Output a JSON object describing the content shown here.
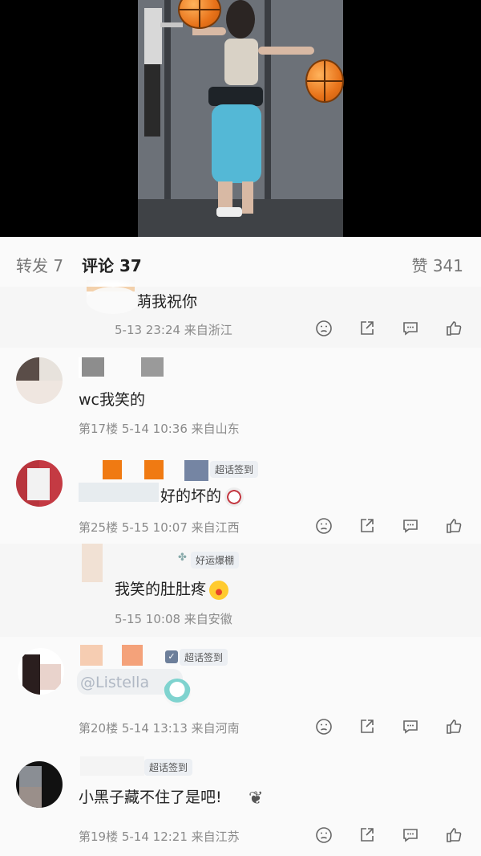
{
  "tabs": {
    "repost": "转发 7",
    "comments": "评论 37",
    "likes": "赞 341"
  },
  "comments": [
    {
      "text": "萌我祝你",
      "meta": "5-13 23:24 来自浙江",
      "is_reply": true
    },
    {
      "text": "wc我笑的",
      "meta": "第17楼 5-14 10:36 来自山东",
      "is_reply": false
    },
    {
      "badge": "超话签到",
      "text": "好的坏的",
      "meta": "第25楼 5-15 10:07 来自江西",
      "is_reply": false
    },
    {
      "badge": "好运爆棚",
      "text": "我笑的肚肚疼",
      "meta": "5-15 10:08 来自安徽",
      "is_reply": true
    },
    {
      "badge": "超话签到",
      "text": "@Listella",
      "meta": "第20楼 5-14 13:13 来自河南",
      "is_reply": false
    },
    {
      "badge": "超话签到",
      "text": "小黑子藏不住了是吧!",
      "meta": "第19楼 5-14 12:21 来自江苏",
      "is_reply": false
    }
  ],
  "icons": {
    "dislike": "dislike-face-icon",
    "share": "share-icon",
    "reply": "reply-icon",
    "like": "thumbs-up-icon"
  }
}
